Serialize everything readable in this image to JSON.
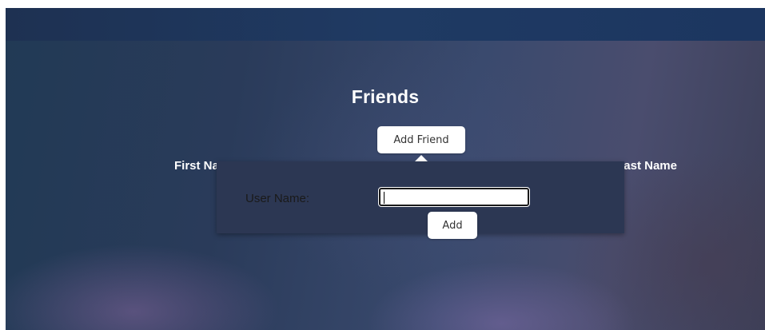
{
  "page": {
    "title": "Friends"
  },
  "toolbar": {
    "add_friend_label": "Add Friend"
  },
  "table": {
    "columns": [
      "First Name",
      "Last Name"
    ]
  },
  "popover": {
    "username_label": "User Name:",
    "username_value": "",
    "add_label": "Add"
  }
}
